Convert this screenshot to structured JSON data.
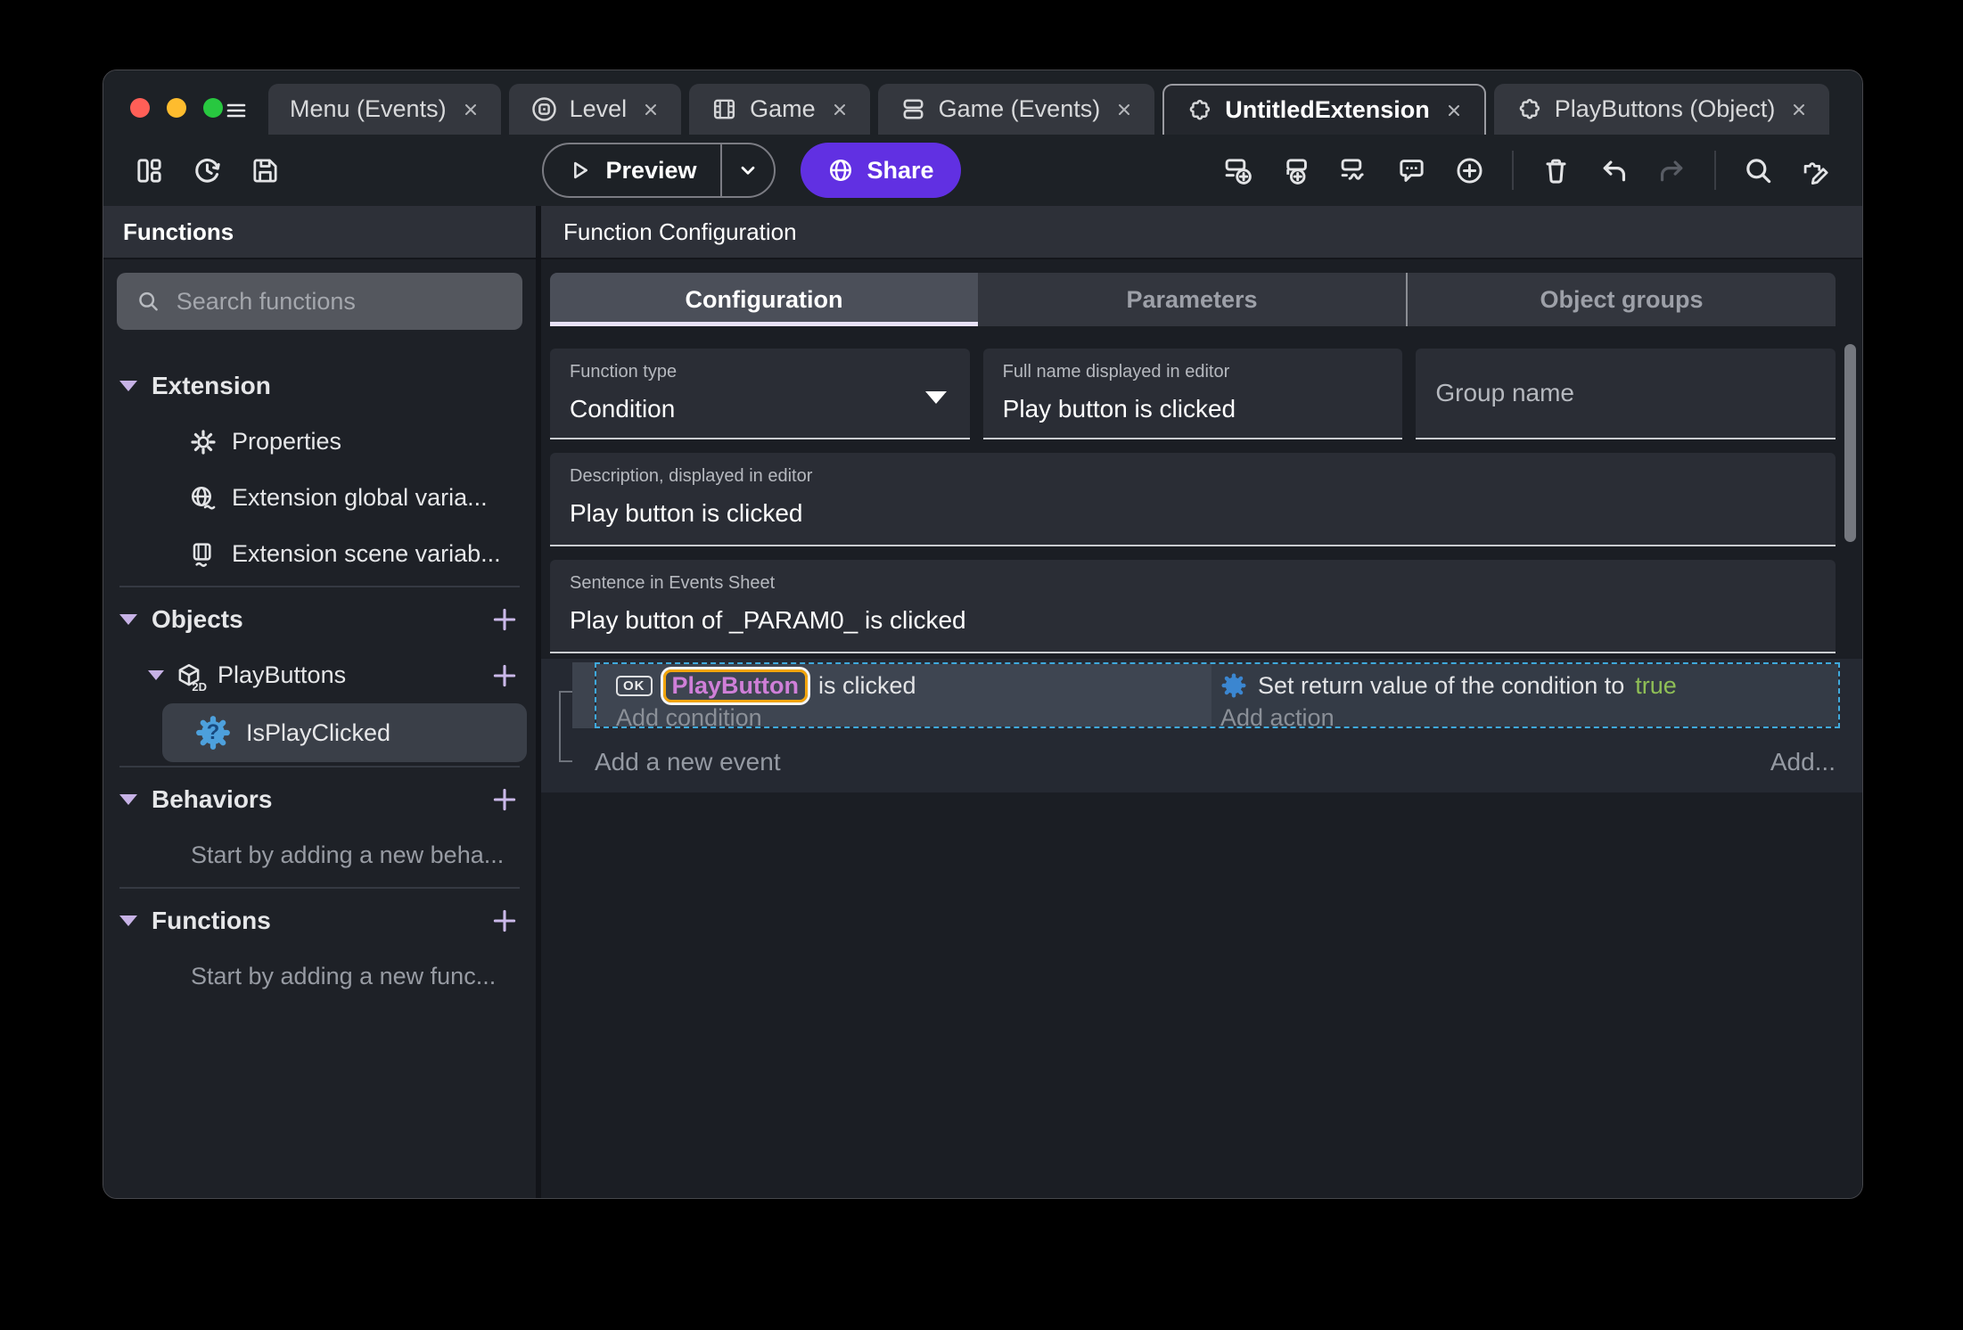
{
  "tabs": [
    {
      "label": "Menu (Events)"
    },
    {
      "label": "Level"
    },
    {
      "label": "Game"
    },
    {
      "label": "Game (Events)"
    },
    {
      "label": "UntitledExtension"
    },
    {
      "label": "PlayButtons (Object)"
    }
  ],
  "toolbar": {
    "preview": "Preview",
    "share": "Share"
  },
  "sidebar": {
    "title": "Functions",
    "search_placeholder": "Search functions",
    "sections": {
      "extension": "Extension",
      "objects": "Objects",
      "behaviors": "Behaviors",
      "functions": "Functions"
    },
    "extension_items": [
      {
        "label": "Properties"
      },
      {
        "label": "Extension global varia..."
      },
      {
        "label": "Extension scene variab..."
      }
    ],
    "object_name": "PlayButtons",
    "object_function": "IsPlayClicked",
    "object_icon_label": "2D",
    "function_icon_glyph": "?",
    "behaviors_hint": "Start by adding a new beha...",
    "functions_hint": "Start by adding a new func..."
  },
  "main": {
    "title": "Function Configuration",
    "tabs": [
      {
        "label": "Configuration"
      },
      {
        "label": "Parameters"
      },
      {
        "label": "Object groups"
      }
    ],
    "fields": {
      "function_type": {
        "label": "Function type",
        "value": "Condition"
      },
      "full_name": {
        "label": "Full name displayed in editor",
        "value": "Play button is clicked"
      },
      "group_name": {
        "placeholder": "Group name"
      },
      "description": {
        "label": "Description, displayed in editor",
        "value": "Play button is clicked"
      },
      "sentence": {
        "label": "Sentence in Events Sheet",
        "value": "Play button of _PARAM0_ is clicked"
      }
    }
  },
  "events_sheet": {
    "ok_badge": "OK",
    "condition_object": "PlayButton",
    "condition_text": "is clicked",
    "add_condition": "Add condition",
    "action_text": "Set return value of the condition to",
    "action_value": "true",
    "add_action": "Add action",
    "add_new_event": "Add a new event",
    "add_button": "Add..."
  },
  "colors": {
    "accent_purple": "#6130e2",
    "object_name_text": "#cf7fd8",
    "selected_instruction_border": "#f2a50c",
    "true_value_green": "#8fbf56",
    "selected_event_border": "#3fa9dc",
    "traffic_red": "#ff5f57",
    "traffic_amber": "#febc2e",
    "traffic_green": "#28c840"
  }
}
